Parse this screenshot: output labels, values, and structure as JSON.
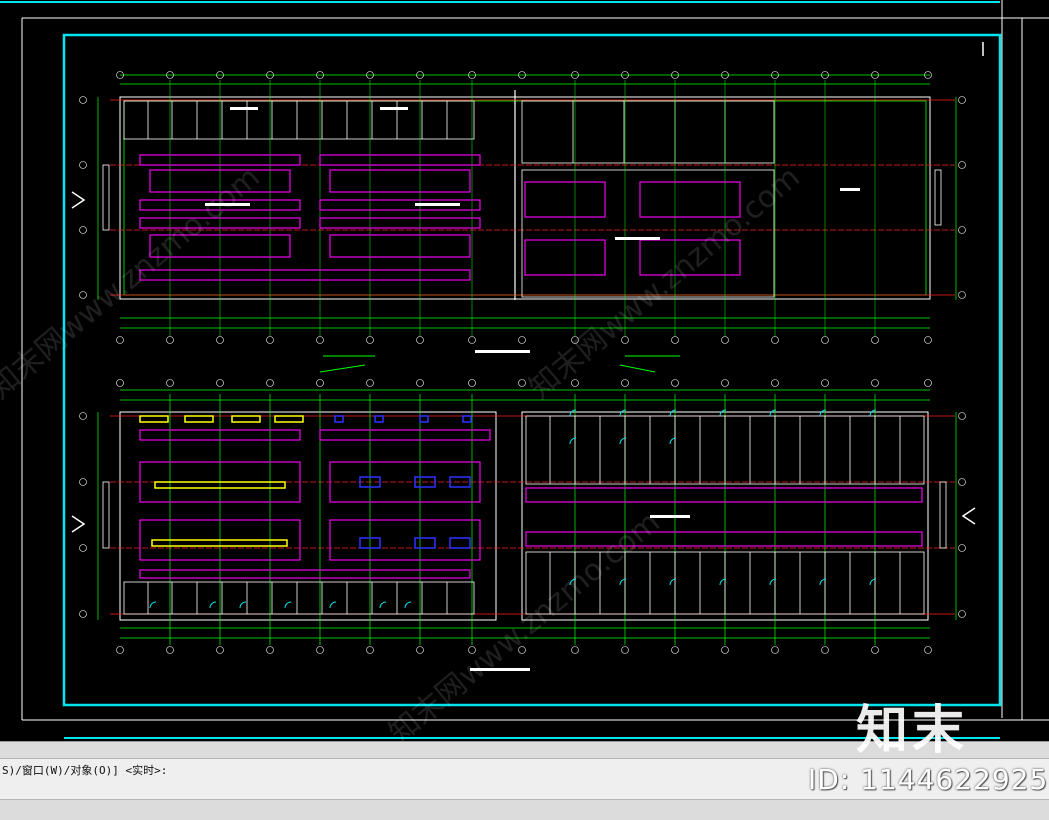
{
  "command_line": {
    "prompt": "S)/窗口(W)/对象(O)] <实时>:"
  },
  "watermark": {
    "logo": "知末",
    "id_label": "ID: 1144622925",
    "diag_text": "知末网www.znzmo.com"
  },
  "colors": {
    "frame": "#00e5ee",
    "wall": "#ff0000",
    "grid": "#00ff00",
    "furniture": "#e000e0",
    "yellow": "#ffff00",
    "blue": "#3030ff",
    "white": "#ffffff"
  }
}
